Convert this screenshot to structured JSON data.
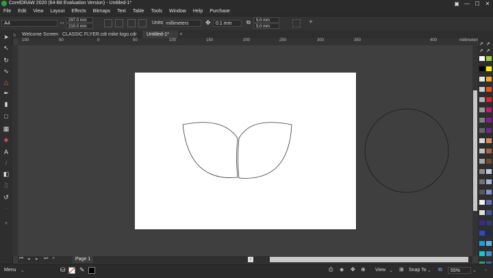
{
  "window": {
    "title": "CorelDRAW 2020 (64-Bit Evaluation Version) - Untitled-1*",
    "controls": [
      "▣",
      "—",
      "☐",
      "✕"
    ]
  },
  "menu": [
    "File",
    "Edit",
    "View",
    "Layout",
    "Effects",
    "Bitmaps",
    "Text",
    "Table",
    "Tools",
    "Window",
    "Help",
    "Purchase"
  ],
  "properties": {
    "page_size": "A4",
    "width": "297.0 mm",
    "height": "210.0 mm",
    "units_label": "Units:",
    "units": "millimeters",
    "nudge": "0.1 mm",
    "dup_x": "5.0 mm",
    "dup_y": "5.0 mm"
  },
  "tabs": [
    {
      "label": "Welcome Screen",
      "active": false
    },
    {
      "label": "CLASSIC FLYER.cdr",
      "active": false
    },
    {
      "label": "mike logo.cdr",
      "active": false
    },
    {
      "label": "Untitled-1*",
      "active": true
    }
  ],
  "ruler": {
    "ticks": [
      "100",
      "50",
      "0",
      "50",
      "100",
      "150",
      "200",
      "250",
      "300",
      "350",
      "400"
    ],
    "unit": "millimeters"
  },
  "page_nav": {
    "page_label": "Page 1"
  },
  "status": {
    "menu": "Menu",
    "view": "View",
    "snap": "Snap To",
    "zoom": "55%"
  },
  "palette_colors": [
    "#ffffff",
    "#000000",
    "#e6e6e6",
    "#cfcfcf",
    "#b3b3b3",
    "#999999",
    "#808080",
    "#666666",
    "#d9d9d9",
    "#bfbfbf",
    "#a6a6a6",
    "#8c8c8c",
    "#737373",
    "#595959",
    "#f2f2f2",
    "#e0e0e0",
    "#3a2c8c",
    "#2b4cc8",
    "#1aa0e0",
    "#16c8d0",
    "#19b46a",
    "#9ad033",
    "#ffee00",
    "#f5a623",
    "#e8541c",
    "#e0202c",
    "#c8186c",
    "#8c1a8c",
    "#6a2a8c",
    "#d88c5a",
    "#a8643c",
    "#6e4a32",
    "#c0c8e0",
    "#a0b0d8",
    "#8090c8",
    "#6070b0",
    "#405890",
    "#2b3c70",
    "#1c2c58",
    "#5ab0e8",
    "#3c8cd0",
    "#2c6cb0"
  ]
}
